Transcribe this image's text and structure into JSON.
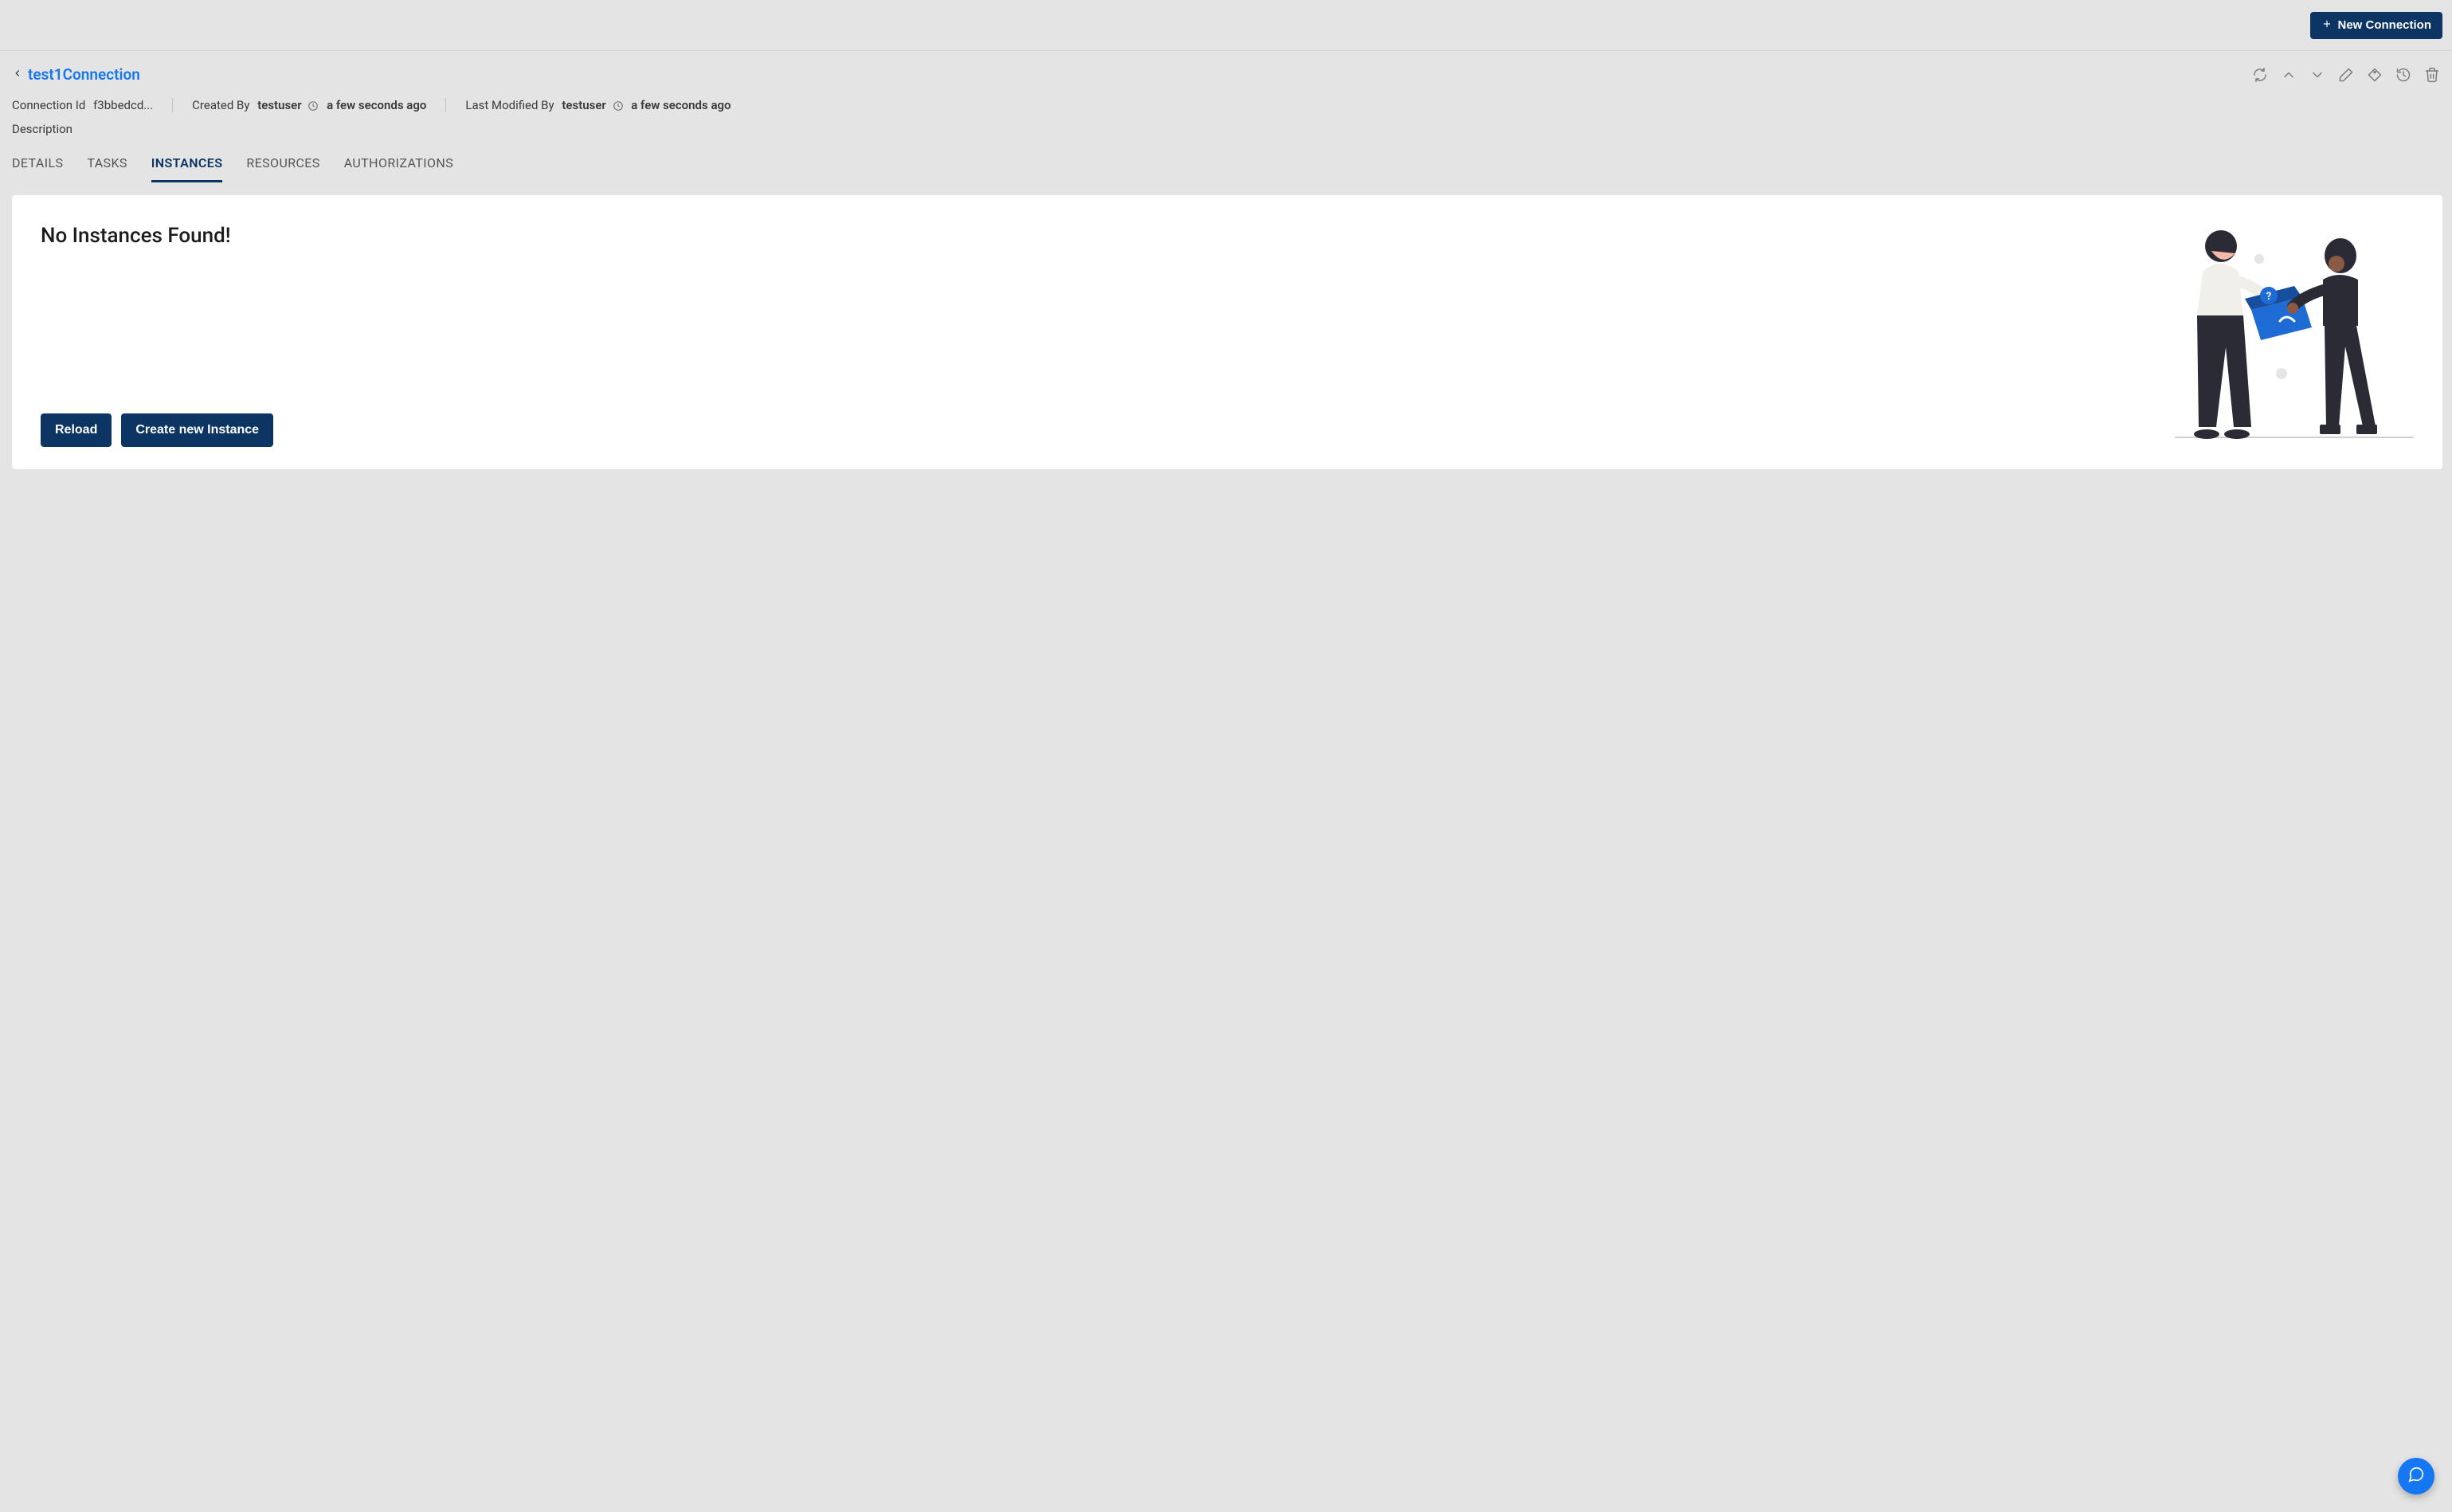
{
  "topbar": {
    "new_connection_label": "New Connection"
  },
  "header": {
    "title": "test1Connection",
    "meta": {
      "connection_id_label": "Connection Id",
      "connection_id_value": "f3bbedcd...",
      "created_by_label": "Created By",
      "created_by_user": "testuser",
      "created_by_ago": "a few seconds ago",
      "last_modified_by_label": "Last Modified By",
      "last_modified_by_user": "testuser",
      "last_modified_by_ago": "a few seconds ago"
    },
    "description_label": "Description"
  },
  "tabs": {
    "items": [
      {
        "label": "DETAILS"
      },
      {
        "label": "TASKS"
      },
      {
        "label": "INSTANCES"
      },
      {
        "label": "RESOURCES"
      },
      {
        "label": "AUTHORIZATIONS"
      }
    ],
    "active_index": 2
  },
  "card": {
    "title": "No Instances Found!",
    "reload_label": "Reload",
    "create_instance_label": "Create new Instance"
  }
}
